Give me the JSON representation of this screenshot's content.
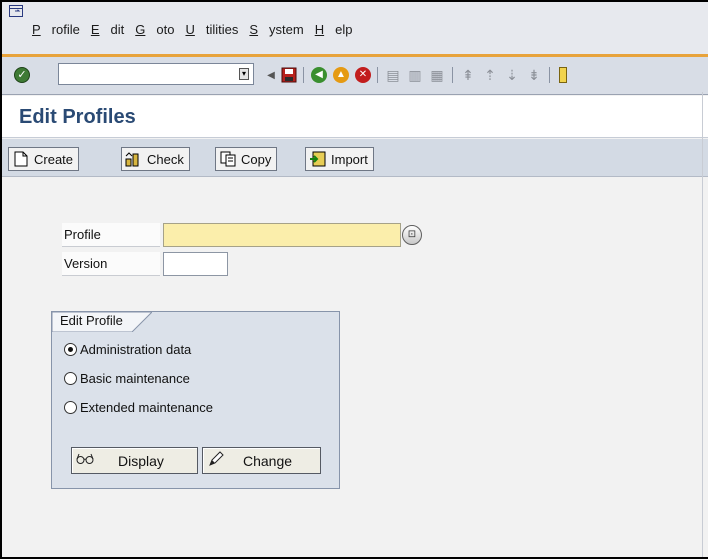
{
  "menu": {
    "system_icon": "window-menu-icon",
    "items": [
      {
        "label": "Profile",
        "mnemonic": "P"
      },
      {
        "label": "Edit",
        "mnemonic": "E"
      },
      {
        "label": "Goto",
        "mnemonic": "G"
      },
      {
        "label": "Utilities",
        "mnemonic": "U"
      },
      {
        "label": "System",
        "mnemonic": "S"
      },
      {
        "label": "Help",
        "mnemonic": "H"
      }
    ]
  },
  "standard_toolbar": {
    "command_field_value": "",
    "icons": [
      "enter-icon",
      "back-arrow-icon",
      "save-icon",
      "back-icon",
      "exit-icon",
      "cancel-icon",
      "print-icon",
      "find-icon",
      "find-next-icon",
      "first-page-icon",
      "previous-page-icon",
      "next-page-icon",
      "last-page-icon"
    ]
  },
  "title": "Edit Profiles",
  "app_toolbar": {
    "buttons": [
      {
        "label": "Create",
        "icon": "create-icon"
      },
      {
        "label": "Check",
        "icon": "check-icon"
      },
      {
        "label": "Copy",
        "icon": "copy-icon"
      },
      {
        "label": "Import",
        "icon": "import-icon"
      }
    ]
  },
  "form": {
    "profile_label": "Profile",
    "profile_value": "",
    "version_label": "Version",
    "version_value": ""
  },
  "edit_profile_group": {
    "title": "Edit Profile",
    "options": [
      {
        "label": "Administration data",
        "selected": true
      },
      {
        "label": "Basic maintenance",
        "selected": false
      },
      {
        "label": "Extended maintenance",
        "selected": false
      }
    ],
    "display_label": "Display",
    "change_label": "Change"
  },
  "colors": {
    "title": "#2a4a74",
    "required_field": "#fbeeab",
    "accent_line": "#e8a33b"
  }
}
